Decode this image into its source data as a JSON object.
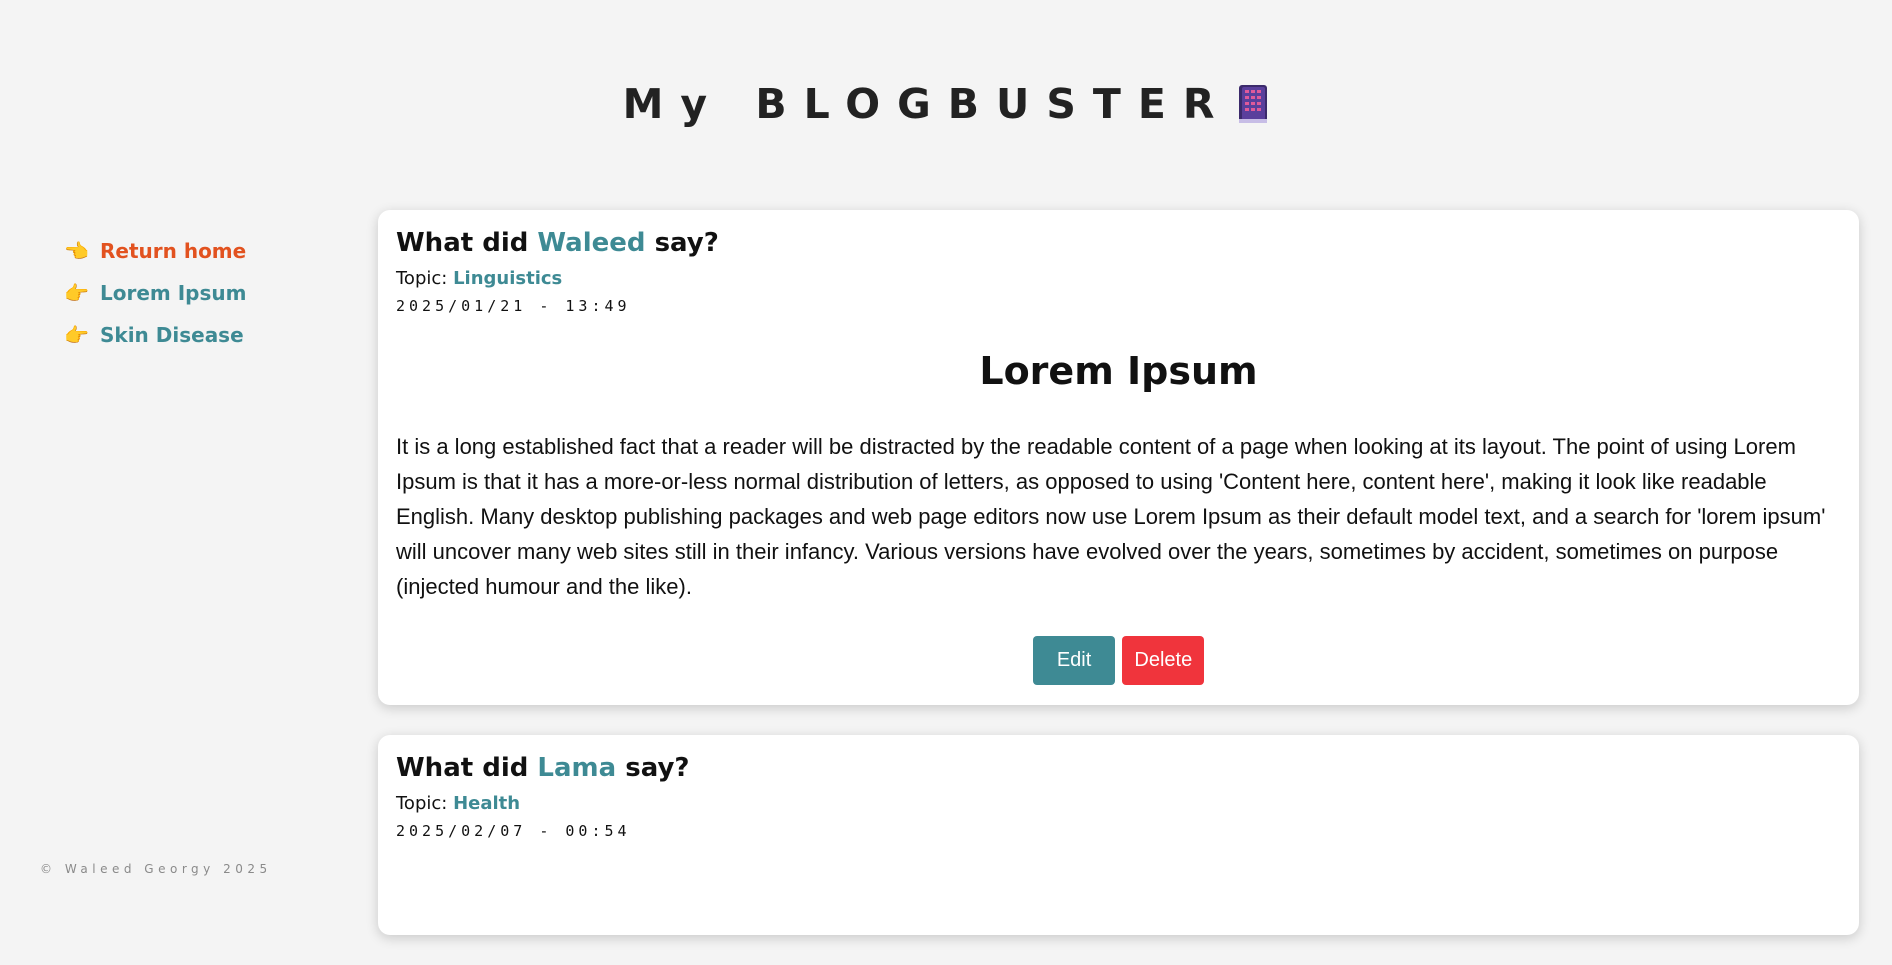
{
  "site": {
    "title": "My BLOGBUSTER",
    "book_icon": "notebook-emoji"
  },
  "sidebar": {
    "items": [
      {
        "icon": "👈",
        "icon_name": "pointing-left-hand-icon",
        "label": "Return home",
        "active": true
      },
      {
        "icon": "👉",
        "icon_name": "pointing-right-hand-icon",
        "label": "Lorem Ipsum",
        "active": false
      },
      {
        "icon": "👉",
        "icon_name": "pointing-right-hand-icon",
        "label": "Skin Disease",
        "active": false
      }
    ]
  },
  "footer": {
    "text": "© Waleed Georgy 2025"
  },
  "posts": [
    {
      "heading_prefix": "What did",
      "author": "Waleed",
      "heading_suffix": "say?",
      "topic_label": "Topic:",
      "topic": "Linguistics",
      "timestamp": "2025/01/21 - 13:49",
      "title": "Lorem Ipsum",
      "body": "It is a long established fact that a reader will be distracted by the readable content of a page when looking at its layout. The point of using Lorem Ipsum is that it has a more-or-less normal distribution of letters, as opposed to using 'Content here, content here', making it look like readable English. Many desktop publishing packages and web page editors now use Lorem Ipsum as their default model text, and a search for 'lorem ipsum' will uncover many web sites still in their infancy. Various versions have evolved over the years, sometimes by accident, sometimes on purpose (injected humour and the like).",
      "edit_label": "Edit",
      "delete_label": "Delete"
    },
    {
      "heading_prefix": "What did",
      "author": "Lama",
      "heading_suffix": "say?",
      "topic_label": "Topic:",
      "topic": "Health",
      "timestamp": "2025/02/07 - 00:54"
    }
  ],
  "colors": {
    "accent": "#3e8a94",
    "active_nav": "#e2521f",
    "delete": "#f0343c",
    "background": "#f4f4f4"
  }
}
